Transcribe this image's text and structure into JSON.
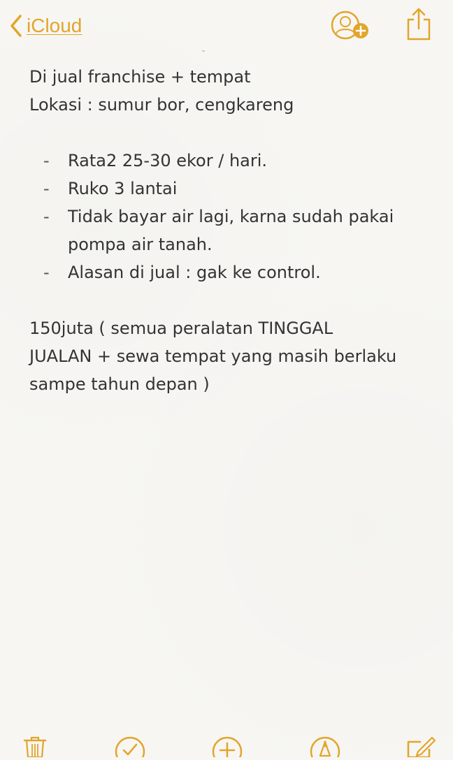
{
  "nav": {
    "back_label": "iCloud"
  },
  "note": {
    "line1": "Di jual franchise + tempat",
    "line2": "Lokasi : sumur bor, cengkareng",
    "bullets": [
      "Rata2 25-30 ekor / hari.",
      "Ruko 3 lantai",
      "Tidak bayar air lagi, karna sudah pakai pompa air tanah.",
      "Alasan di jual : gak ke control."
    ],
    "bullet_marker": "-",
    "price_line1": "150juta ( semua peralatan TINGGAL",
    "price_line2": "JUALAN + sewa tempat yang masih berlaku",
    "price_line3": "sampe tahun depan )"
  },
  "toolbar": {
    "icons": [
      "trash-icon",
      "checklist-icon",
      "add-icon",
      "markup-icon",
      "compose-icon"
    ]
  },
  "colors": {
    "accent": "#e2a52a",
    "background": "#f7f6f3",
    "text": "#333333"
  }
}
